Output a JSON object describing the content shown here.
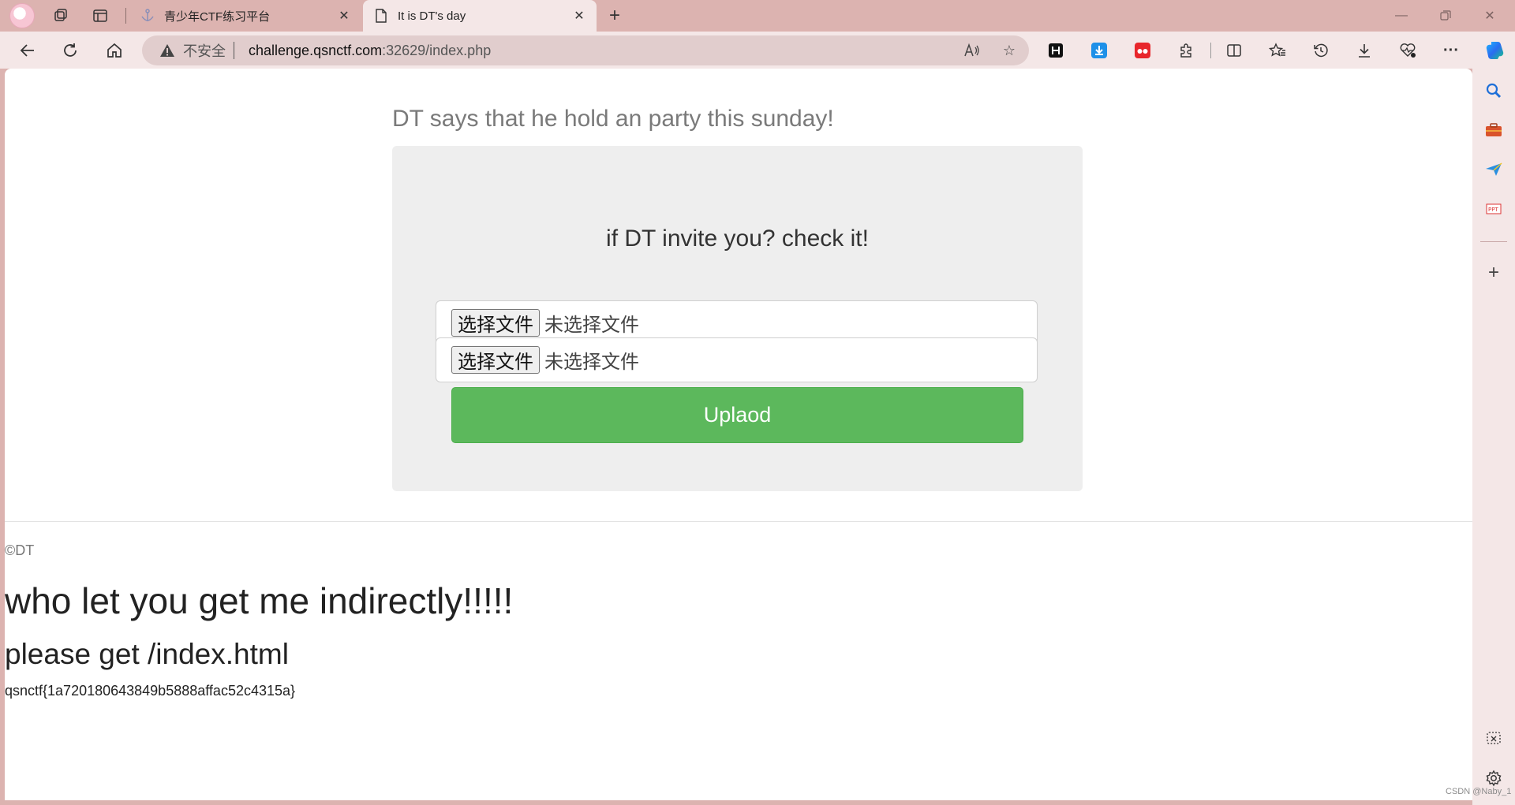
{
  "browser": {
    "tabs": [
      {
        "title": "青少年CTF练习平台",
        "active": false
      },
      {
        "title": "It is DT's day",
        "active": true
      }
    ],
    "address": {
      "security_label": "不安全",
      "host": "challenge.qsnctf.com",
      "path": ":32629/index.php"
    }
  },
  "page": {
    "heading": "DT says that he hold an party this sunday!",
    "panel_title": "if DT invite you? check it!",
    "file_inputs": [
      {
        "button_label": "选择文件",
        "status": "未选择文件"
      },
      {
        "button_label": "选择文件",
        "status": "未选择文件"
      }
    ],
    "upload_label": "Uplaod",
    "copyright": "©DT",
    "message_1": "who let you get me indirectly!!!!!",
    "message_2": "please get /index.html",
    "flag": "qsnctf{1a720180643849b5888affac52c4315a}"
  },
  "watermark": "CSDN @Naby_1",
  "colors": {
    "upload_button": "#5cb85c",
    "panel_bg": "#eeeeee",
    "chrome_bg": "#dcb3b0",
    "toolbar_bg": "#f4e7e7"
  }
}
